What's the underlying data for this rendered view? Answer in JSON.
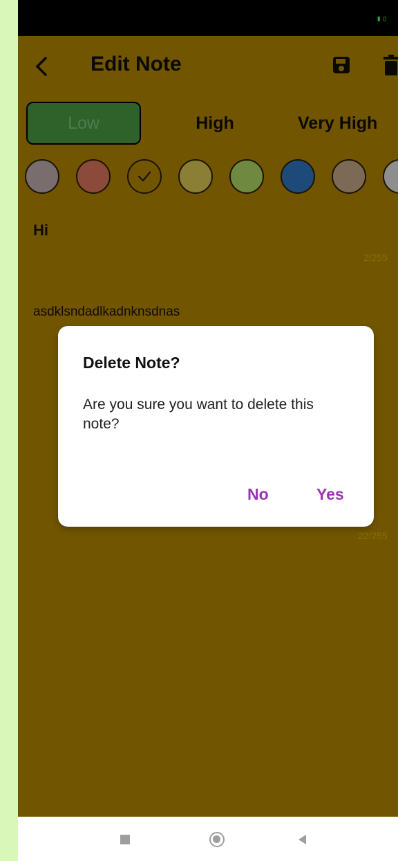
{
  "status_bar": {
    "battery_icon": "battery-icon"
  },
  "app_bar": {
    "title": "Edit Note",
    "back_icon": "chevron-left-icon",
    "save_icon": "floppy-disk-icon",
    "delete_icon": "trash-icon"
  },
  "priority": {
    "options": [
      "Low",
      "High",
      "Very High"
    ],
    "selected": "Low",
    "selected_color": "#2f622a"
  },
  "color_swatches": {
    "colors": [
      "#7a6d6d",
      "#8c4a3a",
      "#725500",
      "#8b7f35",
      "#6f8a40",
      "#1e4a7a",
      "#7d6a56",
      "#8e8e8e"
    ],
    "selected_index": 2
  },
  "note": {
    "title": "Hi",
    "title_counter": "2/255",
    "body": "asdklsndadlkadnknsdnas",
    "body_counter": "22/255"
  },
  "dialog": {
    "title": "Delete Note?",
    "message": "Are you sure you want to delete this note?",
    "no_label": "No",
    "yes_label": "Yes",
    "accent_color": "#9a34b6"
  },
  "nav_bar": {
    "icons": [
      "recents-icon",
      "home-icon",
      "back-icon"
    ]
  }
}
